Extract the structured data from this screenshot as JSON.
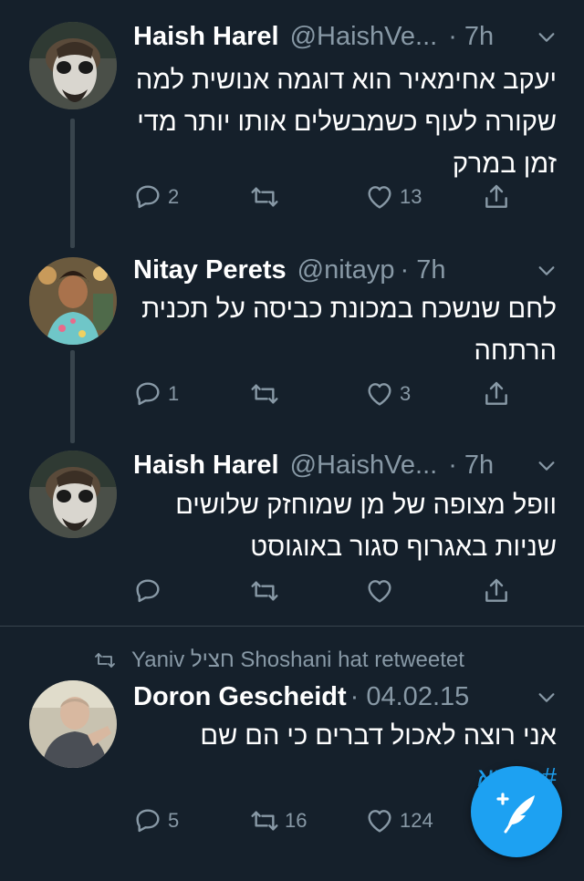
{
  "tweets": [
    {
      "name": "Haish Harel",
      "handle": "@HaishVe...",
      "time": "· 7h",
      "text": "יעקב אחימאיר הוא דוגמה אנושית למה שקורה לעוף כשמבשלים אותו יותר מדי זמן במרק",
      "replies": "2",
      "retweets": "",
      "likes": "13"
    },
    {
      "name": "Nitay Perets",
      "handle": "@nitayp",
      "time": "· 7h",
      "text": "לחם שנשכח במכונת כביסה על תכנית הרתחה",
      "replies": "1",
      "retweets": "",
      "likes": "3"
    },
    {
      "name": "Haish Harel",
      "handle": "@HaishVe...",
      "time": "· 7h",
      "text": "וופל מצופה של מן שמוחזק שלושים שניות באגרוף סגור באוגוסט",
      "replies": "",
      "retweets": "",
      "likes": ""
    },
    {
      "retweeted_by": "Yaniv חציל Shoshani hat retweetet",
      "name": "Doron Gescheidt",
      "handle": "",
      "time": "· 04.02.15",
      "text": "אני רוצה לאכול דברים כי הם שם",
      "hashtag": "#טיוטא",
      "replies": "5",
      "retweets": "16",
      "likes": "124"
    }
  ],
  "icons": {
    "reply": "reply-icon",
    "retweet": "retweet-icon",
    "like": "heart-icon",
    "share": "share-icon",
    "compose": "compose-tweet-icon"
  },
  "colors": {
    "background": "#15202b",
    "secondary_text": "#8899a6",
    "accent": "#1da1f2",
    "divider": "#38444d"
  }
}
